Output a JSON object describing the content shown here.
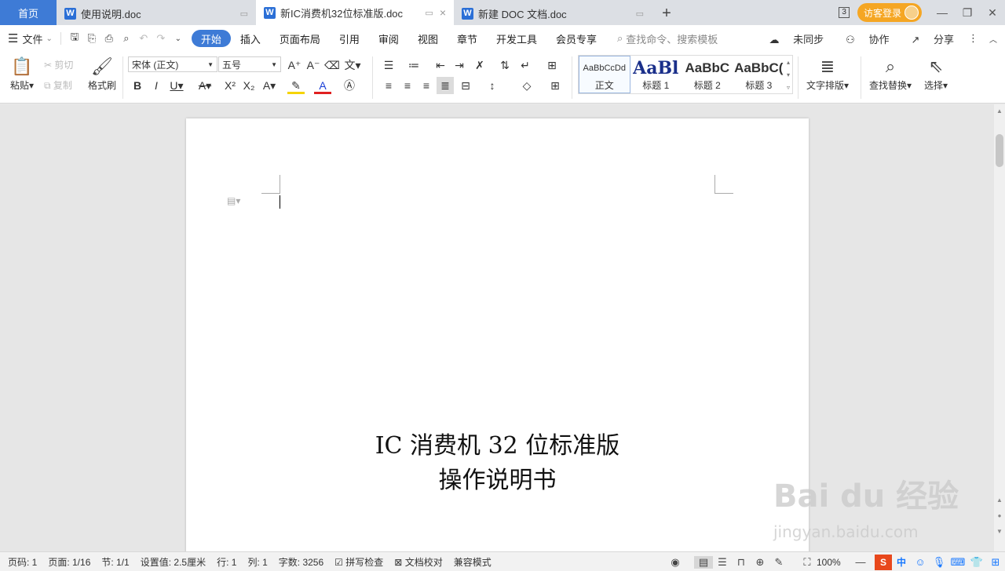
{
  "tabs": {
    "home": "首页",
    "documents": [
      {
        "title": "使用说明.doc",
        "active": false
      },
      {
        "title": "新IC消费机32位标准版.doc",
        "active": true
      },
      {
        "title": "新建 DOC 文档.doc",
        "active": false
      }
    ],
    "add": "+",
    "window_count": "3",
    "login": "访客登录"
  },
  "menu": {
    "file": "文件",
    "tabs": [
      "开始",
      "插入",
      "页面布局",
      "引用",
      "审阅",
      "视图",
      "章节",
      "开发工具",
      "会员专享"
    ],
    "search_placeholder": "查找命令、搜索模板",
    "unsynced": "未同步",
    "collab": "协作",
    "share": "分享"
  },
  "ribbon": {
    "paste": "粘贴",
    "cut": "剪切",
    "copy": "复制",
    "format_painter": "格式刷",
    "font_name": "宋体 (正文)",
    "font_size": "五号",
    "styles": [
      {
        "sample": "AaBbCcDd",
        "label": "正文"
      },
      {
        "sample": "AaBl",
        "label": "标题 1"
      },
      {
        "sample": "AaBbC",
        "label": "标题 2"
      },
      {
        "sample": "AaBbC(",
        "label": "标题 3"
      }
    ],
    "text_layout": "文字排版",
    "find_replace": "查找替换",
    "select": "选择"
  },
  "document": {
    "title_line1": "IC 消费机 32 位标准版",
    "title_line2": "操作说明书"
  },
  "status": {
    "page_num": "页码: 1",
    "page": "页面: 1/16",
    "section": "节: 1/1",
    "position": "设置值: 2.5厘米",
    "line": "行: 1",
    "col": "列: 1",
    "words": "字数: 3256",
    "spell_check": "拼写检查",
    "doc_check": "文档校对",
    "compat_mode": "兼容模式",
    "zoom": "100%",
    "ime_zh": "中"
  },
  "watermark": {
    "brand": "Bai du 经验",
    "url": "jingyan.baidu.com"
  }
}
